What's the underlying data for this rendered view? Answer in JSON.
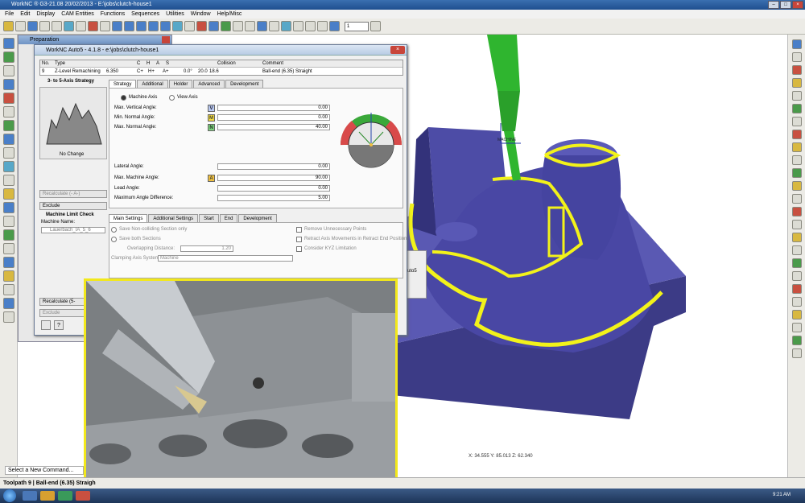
{
  "window": {
    "title": "WorkNC ® G3-21.08  20/02/2013 - E:\\jobs\\clutch-house1"
  },
  "menu": [
    "File",
    "Edit",
    "Display",
    "CAM Entities",
    "Functions",
    "Sequences",
    "Utilities",
    "Window",
    "Help/Misc"
  ],
  "toolbar": {
    "layer_value": "1"
  },
  "prep_panel": {
    "title": "Preparation"
  },
  "dialog": {
    "title": "WorkNC Auto5 - 4.1.8 - e:\\jobs\\clutch-house1",
    "grid": {
      "headers": [
        "No.",
        "Type",
        "",
        "C",
        "H",
        "A",
        "S",
        "Collision",
        "Comment"
      ],
      "row": {
        "no": "9",
        "type": "Z-Level Remachining",
        "size": "6.350",
        "c": "C+",
        "h": "H+",
        "a": "A+",
        "v1": "0.0°",
        "v2": "20.0",
        "v3": "18.6",
        "comment": "Ball-end (6.35) Straight"
      }
    },
    "left": {
      "strategy_title": "3- to 5-Axis Strategy",
      "no_change": "No Change",
      "recalc1": "Recalculate (- A-)",
      "exclude1": "Exclude",
      "limit_title": "Machine Limit Check",
      "machine_name_label": "Machine Name:",
      "machine_name": "Lauerbach_IA_5_6",
      "recalc2": "Recalculate (5-",
      "exclude2": "Exclude"
    },
    "tabs_top": [
      "Strategy",
      "Additional",
      "Holder",
      "Advanced",
      "Development"
    ],
    "strategy": {
      "machine_axis": "Machine Axis",
      "view_axis": "View Axis",
      "max_vert_label": "Max. Vertical Angle:",
      "max_vert": "0.00",
      "min_normal_label": "Min. Normal Angle:",
      "min_normal": "0.00",
      "max_normal_label": "Max. Normal Angle:",
      "max_normal": "40.00",
      "lateral_label": "Lateral Angle:",
      "lateral": "0.00",
      "max_machine_label": "Max. Machine Angle:",
      "max_machine": "90.00",
      "lead_label": "Lead Angle:",
      "lead": "0.00",
      "max_diff_label": "Maximum Angle Difference:",
      "max_diff": "5.00",
      "badge_v": "V",
      "badge_m": "M",
      "badge_n": "N",
      "badge_a": "A"
    },
    "tabs_bottom": [
      "Main Settings",
      "Additional Settings",
      "Start",
      "End",
      "Development"
    ],
    "main": {
      "save_noncolliding": "Save Non-colliding Section only",
      "save_both": "Save both Sections",
      "overlap_label": "Overlapping Distance:",
      "overlap": "1.20",
      "clamping_label": "Clamping Axis System:",
      "clamping": "Machine",
      "remove_points": "Remove Unnecessary Points",
      "retract": "Retract Axis Movements in Retract End Position",
      "kyz": "Consider KYZ Limitation"
    }
  },
  "viewport": {
    "axis_label": "MACHINE",
    "coords": "X: 34.555   Y: 85.013   Z: 62.340",
    "auto5_tab": "uto5"
  },
  "statusbar": {
    "command": "Select a New Command...",
    "toolpath": "Toolpath 9 | Ball-end (6.35) Straigh"
  },
  "taskbar": {
    "time": "9:21 AM"
  },
  "colors": {
    "part": "#4b4a9c",
    "toolpath": "#f2f21a",
    "tool": "#2fb52f",
    "frame": "#f2e81b"
  }
}
